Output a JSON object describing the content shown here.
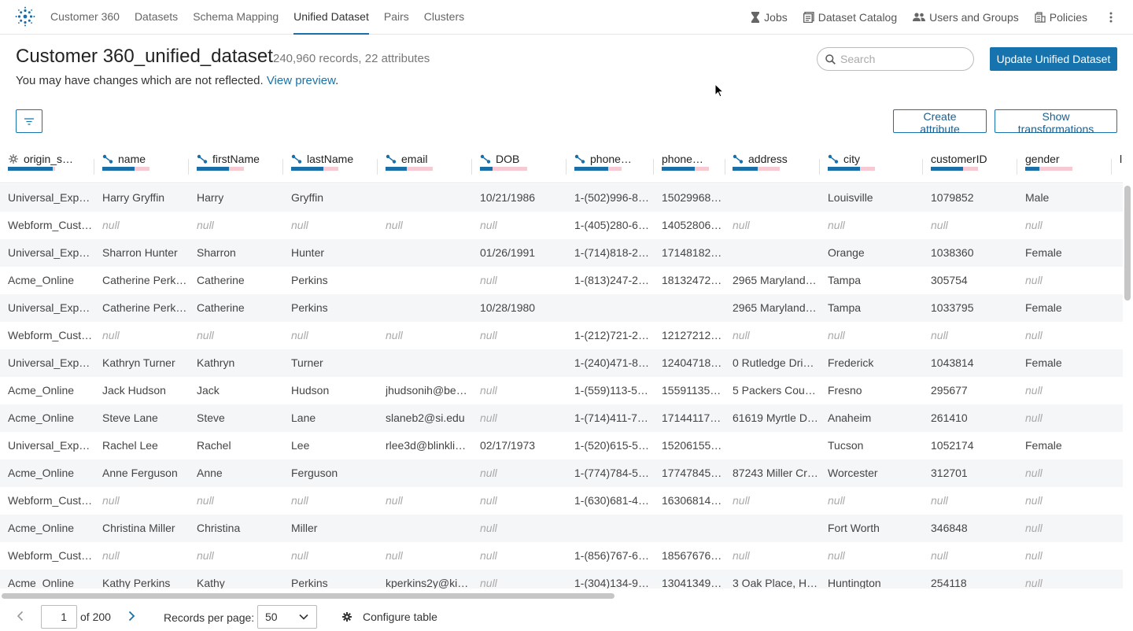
{
  "nav": {
    "tabs": [
      {
        "label": "Customer 360",
        "active": false
      },
      {
        "label": "Datasets",
        "active": false
      },
      {
        "label": "Schema Mapping",
        "active": false
      },
      {
        "label": "Unified Dataset",
        "active": true
      },
      {
        "label": "Pairs",
        "active": false
      },
      {
        "label": "Clusters",
        "active": false
      }
    ],
    "right": {
      "jobs": "Jobs",
      "catalog": "Dataset Catalog",
      "users": "Users and Groups",
      "policies": "Policies"
    }
  },
  "header": {
    "title": "Customer 360_unified_dataset",
    "subtitle": "240,960 records, 22 attributes",
    "notice_text": "You may have changes which are not reflected. ",
    "notice_link": "View preview",
    "notice_end": ".",
    "search_placeholder": "Search",
    "update_button": "Update Unified Dataset",
    "create_attribute": "Create attribute",
    "show_transformations": "Show transformations"
  },
  "colors": {
    "accent": "#1673ad",
    "bar_fill": "#1a6fa8",
    "bar_bg": "#f7c9d3",
    "null_text": "#aaaaaa"
  },
  "table": {
    "columns": [
      {
        "label": "origin_s…",
        "icon": "origin-icon",
        "fill": 0.95
      },
      {
        "label": "name",
        "icon": "mapped-icon",
        "fill": 0.68
      },
      {
        "label": "firstName",
        "icon": "mapped-icon",
        "fill": 0.68
      },
      {
        "label": "lastName",
        "icon": "mapped-icon",
        "fill": 0.68
      },
      {
        "label": "email",
        "icon": "mapped-icon",
        "fill": 0.45
      },
      {
        "label": "DOB",
        "icon": "mapped-icon",
        "fill": 0.27
      },
      {
        "label": "phone…",
        "icon": "mapped-icon",
        "fill": 0.72
      },
      {
        "label": "phone…",
        "icon": "",
        "fill": 0.7
      },
      {
        "label": "address",
        "icon": "mapped-icon",
        "fill": 0.53
      },
      {
        "label": "city",
        "icon": "mapped-icon",
        "fill": 0.68
      },
      {
        "label": "customerID",
        "icon": "",
        "fill": 0.68
      },
      {
        "label": "gender",
        "icon": "",
        "fill": 0.3
      },
      {
        "label": "l",
        "icon": "",
        "fill": 0.0
      }
    ],
    "rows": [
      [
        "Universal_Exp…",
        "Harry Gryffin",
        "Harry",
        "Gryffin",
        "",
        "10/21/1986",
        "1-(502)996-8…",
        "15029968…",
        "",
        "Louisville",
        "1079852",
        "Male",
        ""
      ],
      [
        "Webform_Cust…",
        "null",
        "null",
        "null",
        "null",
        "null",
        "1-(405)280-6…",
        "14052806…",
        "null",
        "null",
        "null",
        "null",
        ""
      ],
      [
        "Universal_Exp…",
        "Sharron Hunter",
        "Sharron",
        "Hunter",
        "",
        "01/26/1991",
        "1-(714)818-2…",
        "17148182…",
        "",
        "Orange",
        "1038360",
        "Female",
        ""
      ],
      [
        "Acme_Online",
        "Catherine Perk…",
        "Catherine",
        "Perkins",
        "",
        "null",
        "1-(813)247-2…",
        "18132472…",
        "2965 Maryland…",
        "Tampa",
        "305754",
        "null",
        ""
      ],
      [
        "Universal_Exp…",
        "Catherine Perk…",
        "Catherine",
        "Perkins",
        "",
        "10/28/1980",
        "",
        "",
        "2965 Maryland…",
        "Tampa",
        "1033795",
        "Female",
        ""
      ],
      [
        "Webform_Cust…",
        "null",
        "null",
        "null",
        "null",
        "null",
        "1-(212)721-2…",
        "12127212…",
        "null",
        "null",
        "null",
        "null",
        ""
      ],
      [
        "Universal_Exp…",
        "Kathryn Turner",
        "Kathryn",
        "Turner",
        "",
        "",
        "1-(240)471-8…",
        "12404718…",
        "0 Rutledge Dri…",
        "Frederick",
        "1043814",
        "Female",
        ""
      ],
      [
        "Acme_Online",
        "Jack Hudson",
        "Jack",
        "Hudson",
        "jhudsonih@be…",
        "null",
        "1-(559)113-5…",
        "15591135…",
        "5 Packers Cour…",
        "Fresno",
        "295677",
        "null",
        ""
      ],
      [
        "Acme_Online",
        "Steve Lane",
        "Steve",
        "Lane",
        "slaneb2@si.edu",
        "null",
        "1-(714)411-7…",
        "17144117…",
        "61619 Myrtle D…",
        "Anaheim",
        "261410",
        "null",
        ""
      ],
      [
        "Universal_Exp…",
        "Rachel Lee",
        "Rachel",
        "Lee",
        "rlee3d@blinkli…",
        "02/17/1973",
        "1-(520)615-5…",
        "15206155…",
        "",
        "Tucson",
        "1052174",
        "Female",
        ""
      ],
      [
        "Acme_Online",
        "Anne Ferguson",
        "Anne",
        "Ferguson",
        "",
        "null",
        "1-(774)784-5…",
        "17747845…",
        "87243 Miller Cr…",
        "Worcester",
        "312701",
        "null",
        ""
      ],
      [
        "Webform_Cust…",
        "null",
        "null",
        "null",
        "null",
        "null",
        "1-(630)681-4…",
        "16306814…",
        "null",
        "null",
        "null",
        "null",
        ""
      ],
      [
        "Acme_Online",
        "Christina Miller",
        "Christina",
        "Miller",
        "",
        "null",
        "",
        "",
        "",
        "Fort Worth",
        "346848",
        "null",
        ""
      ],
      [
        "Webform_Cust…",
        "null",
        "null",
        "null",
        "null",
        "null",
        "1-(856)767-6…",
        "18567676…",
        "null",
        "null",
        "null",
        "null",
        ""
      ],
      [
        "Acme_Online",
        "Kathy Perkins",
        "Kathy",
        "Perkins",
        "kperkins2y@ki…",
        "null",
        "1-(304)134-9…",
        "13041349…",
        "3 Oak Place, H…",
        "Huntington",
        "254118",
        "null",
        ""
      ]
    ]
  },
  "footer": {
    "page": "1",
    "of_pages": "of 200",
    "records_per_page_label": "Records per page:",
    "records_per_page": "50",
    "configure_table": "Configure table"
  }
}
